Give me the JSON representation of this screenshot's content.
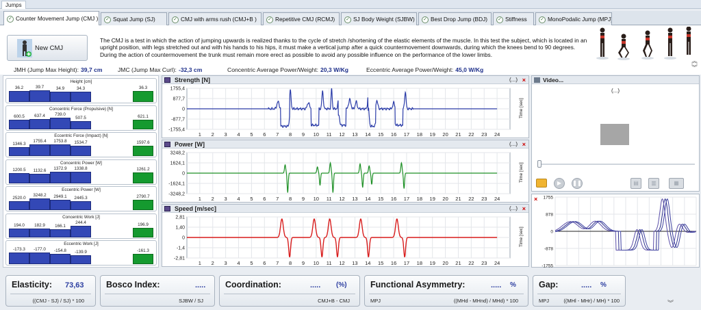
{
  "top_tab": "Jumps",
  "tabs": [
    {
      "label": "Counter Movement Jump (CMJ )",
      "active": true
    },
    {
      "label": "Squat Jump (SJ)"
    },
    {
      "label": "CMJ with arms rush (CMJ+B )"
    },
    {
      "label": "Repetitive CMJ (RCMJ)"
    },
    {
      "label": "SJ Body Weight (SJBW)"
    },
    {
      "label": "Best Drop Jump (BDJ)"
    },
    {
      "label": "Stiffness"
    },
    {
      "label": "MonoPodalic Jump (MPJ)"
    }
  ],
  "new_button": "New CMJ",
  "description": "The CMJ is a test in which the action of jumping upwards is realized thanks to the cycle of stretch /shortening of the elastic elements of the muscle. In this test the subject, which is located in an upright position, with legs stretched out and with his hands  to his hips, it must make a vertical jump after a quick countermovement downwards, during which the knees bend to 90 degrees. During the action of countermovement the trunk must remain more erect as possible to avoid any possible influence on the performance of the lower limbs.",
  "metrics": {
    "jmh_label": "JMH (Jump Max Height):",
    "jmh_value": "39,7 cm",
    "jmc_label": "JMC (Jump Max Curl):",
    "jmc_value": "-32,3 cm",
    "cap_label": "Concentric Average Power/Weight:",
    "cap_value": "20,3 W/Kg",
    "eap_label": "Eccentric Average Power/Weight:",
    "eap_value": "45,0 W/Kg"
  },
  "bar_groups": [
    {
      "title": "Height [cm]",
      "labels": [
        "36.2",
        "39.7",
        "34.9",
        "34.3"
      ],
      "values": [
        36.2,
        39.7,
        34.9,
        34.3
      ],
      "avg_label": "36.3",
      "avg": 36.3
    },
    {
      "title": "Concentric Force (Propulsive) [N]",
      "labels": [
        "600.5",
        "637.4",
        "739.0",
        "507.5"
      ],
      "values": [
        600.5,
        637.4,
        739.0,
        507.5
      ],
      "avg_label": "621.1",
      "avg": 621.1
    },
    {
      "title": "Eccentric Force (Impact) [N]",
      "labels": [
        "1346.3",
        "1755.4",
        "1753.8",
        "1534.7"
      ],
      "values": [
        1346.3,
        1755.4,
        1753.8,
        1534.7
      ],
      "avg_label": "1597.6",
      "avg": 1597.6
    },
    {
      "title": "Concentric Power [W]",
      "labels": [
        "1200.5",
        "1132.6",
        "1372.9",
        "1338.8"
      ],
      "values": [
        1200.5,
        1132.6,
        1372.9,
        1338.8
      ],
      "avg_label": "1261.2",
      "avg": 1261.2
    },
    {
      "title": "Eccentric Power [W]",
      "labels": [
        "2520.0",
        "3248.2",
        "2949.1",
        "2445.3"
      ],
      "values": [
        2520.0,
        3248.2,
        2949.1,
        2445.3
      ],
      "avg_label": "2790.7",
      "avg": 2790.7
    },
    {
      "title": "Concentric Work [J]",
      "labels": [
        "194.0",
        "182.9",
        "166.1",
        "244.4"
      ],
      "values": [
        194.0,
        182.9,
        166.1,
        244.4
      ],
      "avg_label": "196.9",
      "avg": 196.9
    },
    {
      "title": "Eccentric Work [J]",
      "labels": [
        "-173.3",
        "-177.0",
        "-154.8",
        "-139.9"
      ],
      "values": [
        173.3,
        177.0,
        154.8,
        139.9
      ],
      "avg_label": "-161.3",
      "avg": 161.3
    }
  ],
  "chart_more": "(...)",
  "chart_close": "×",
  "chart_time_label": "Time [sec]",
  "chart_data": [
    {
      "type": "line",
      "title": "Strength [N]",
      "yticks": [
        "1755,4",
        "877,7",
        "0",
        "-877,7",
        "-1755,4"
      ],
      "ylim": [
        -1755.4,
        1755.4
      ],
      "xticks": [
        "1",
        "2",
        "3",
        "4",
        "5",
        "6",
        "7",
        "8",
        "9",
        "10",
        "11",
        "12",
        "13",
        "14",
        "15",
        "16",
        "17",
        "18",
        "19",
        "20",
        "21",
        "22",
        "23",
        "24"
      ],
      "color": "#2a3ba8"
    },
    {
      "type": "line",
      "title": "Power [W]",
      "yticks": [
        "3248,2",
        "1624,1",
        "0",
        "-1624,1",
        "-3248,2"
      ],
      "ylim": [
        -3248.2,
        3248.2
      ],
      "xticks": [
        "1",
        "2",
        "3",
        "4",
        "5",
        "6",
        "7",
        "8",
        "9",
        "10",
        "11",
        "12",
        "13",
        "14",
        "15",
        "16",
        "17",
        "18",
        "19",
        "20",
        "21",
        "22",
        "23",
        "24"
      ],
      "color": "#1c8f24"
    },
    {
      "type": "line",
      "title": "Speed [m/sec]",
      "yticks": [
        "2,81",
        "1,40",
        "0",
        "-1,4",
        "-2,81"
      ],
      "ylim": [
        -2.81,
        2.81
      ],
      "xticks": [
        "1",
        "2",
        "3",
        "4",
        "5",
        "6",
        "7",
        "8",
        "9",
        "10",
        "11",
        "12",
        "13",
        "14",
        "15",
        "16",
        "17",
        "18",
        "19",
        "20",
        "21",
        "22",
        "23",
        "24"
      ],
      "color": "#d81c1c"
    },
    {
      "type": "line",
      "title": "",
      "yticks": [
        "1755",
        "878",
        "0",
        "-878",
        "-1755"
      ],
      "ylim": [
        -1755,
        1755
      ],
      "color": "#2e2f8a"
    }
  ],
  "video": {
    "title": "Video...",
    "status": "(...)"
  },
  "cards": [
    {
      "label": "Elasticity:",
      "value": "73,63",
      "unit": "",
      "left_sub": "",
      "right_sub": "((CMJ - SJ) / SJ) * 100"
    },
    {
      "label": "Bosco Index:",
      "value": ".....",
      "unit": "",
      "left_sub": "",
      "right_sub": "SJBW / SJ"
    },
    {
      "label": "Coordination:",
      "value": ".....",
      "unit": "(%)",
      "left_sub": "",
      "right_sub": "CMJ+B - CMJ"
    },
    {
      "label": "Functional Asymmetry:",
      "value": ".....",
      "unit": "%",
      "left_sub": "MPJ",
      "right_sub": "((MHd - MHnd) / MHd) * 100"
    },
    {
      "label": "Gap:",
      "value": ".....",
      "unit": "%",
      "left_sub": "MPJ",
      "right_sub": "((MHl - MHr) / MH) * 100"
    }
  ]
}
